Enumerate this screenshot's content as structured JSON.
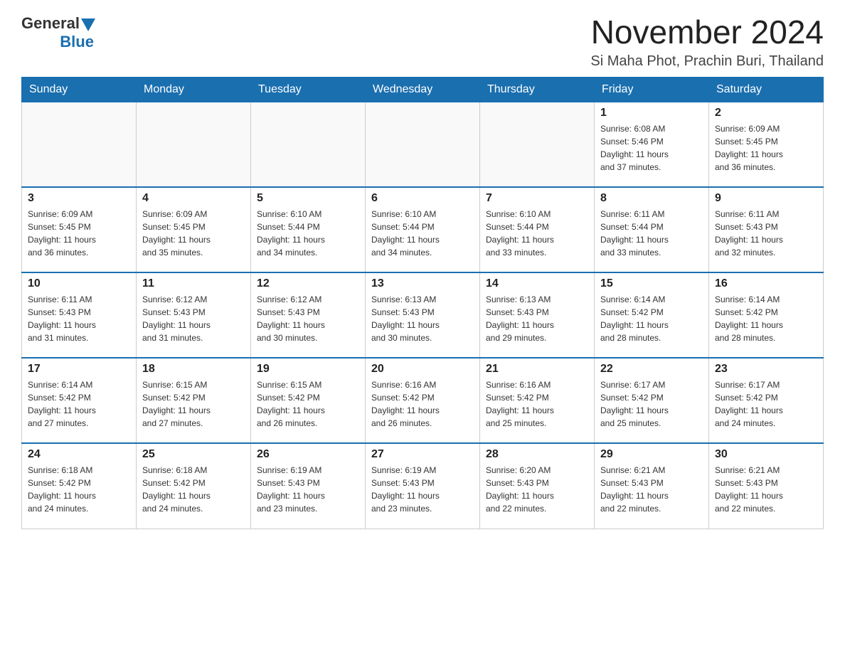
{
  "header": {
    "logo_general": "General",
    "logo_blue": "Blue",
    "month_title": "November 2024",
    "location": "Si Maha Phot, Prachin Buri, Thailand"
  },
  "days_of_week": [
    "Sunday",
    "Monday",
    "Tuesday",
    "Wednesday",
    "Thursday",
    "Friday",
    "Saturday"
  ],
  "weeks": [
    [
      {
        "day": "",
        "info": ""
      },
      {
        "day": "",
        "info": ""
      },
      {
        "day": "",
        "info": ""
      },
      {
        "day": "",
        "info": ""
      },
      {
        "day": "",
        "info": ""
      },
      {
        "day": "1",
        "info": "Sunrise: 6:08 AM\nSunset: 5:46 PM\nDaylight: 11 hours\nand 37 minutes."
      },
      {
        "day": "2",
        "info": "Sunrise: 6:09 AM\nSunset: 5:45 PM\nDaylight: 11 hours\nand 36 minutes."
      }
    ],
    [
      {
        "day": "3",
        "info": "Sunrise: 6:09 AM\nSunset: 5:45 PM\nDaylight: 11 hours\nand 36 minutes."
      },
      {
        "day": "4",
        "info": "Sunrise: 6:09 AM\nSunset: 5:45 PM\nDaylight: 11 hours\nand 35 minutes."
      },
      {
        "day": "5",
        "info": "Sunrise: 6:10 AM\nSunset: 5:44 PM\nDaylight: 11 hours\nand 34 minutes."
      },
      {
        "day": "6",
        "info": "Sunrise: 6:10 AM\nSunset: 5:44 PM\nDaylight: 11 hours\nand 34 minutes."
      },
      {
        "day": "7",
        "info": "Sunrise: 6:10 AM\nSunset: 5:44 PM\nDaylight: 11 hours\nand 33 minutes."
      },
      {
        "day": "8",
        "info": "Sunrise: 6:11 AM\nSunset: 5:44 PM\nDaylight: 11 hours\nand 33 minutes."
      },
      {
        "day": "9",
        "info": "Sunrise: 6:11 AM\nSunset: 5:43 PM\nDaylight: 11 hours\nand 32 minutes."
      }
    ],
    [
      {
        "day": "10",
        "info": "Sunrise: 6:11 AM\nSunset: 5:43 PM\nDaylight: 11 hours\nand 31 minutes."
      },
      {
        "day": "11",
        "info": "Sunrise: 6:12 AM\nSunset: 5:43 PM\nDaylight: 11 hours\nand 31 minutes."
      },
      {
        "day": "12",
        "info": "Sunrise: 6:12 AM\nSunset: 5:43 PM\nDaylight: 11 hours\nand 30 minutes."
      },
      {
        "day": "13",
        "info": "Sunrise: 6:13 AM\nSunset: 5:43 PM\nDaylight: 11 hours\nand 30 minutes."
      },
      {
        "day": "14",
        "info": "Sunrise: 6:13 AM\nSunset: 5:43 PM\nDaylight: 11 hours\nand 29 minutes."
      },
      {
        "day": "15",
        "info": "Sunrise: 6:14 AM\nSunset: 5:42 PM\nDaylight: 11 hours\nand 28 minutes."
      },
      {
        "day": "16",
        "info": "Sunrise: 6:14 AM\nSunset: 5:42 PM\nDaylight: 11 hours\nand 28 minutes."
      }
    ],
    [
      {
        "day": "17",
        "info": "Sunrise: 6:14 AM\nSunset: 5:42 PM\nDaylight: 11 hours\nand 27 minutes."
      },
      {
        "day": "18",
        "info": "Sunrise: 6:15 AM\nSunset: 5:42 PM\nDaylight: 11 hours\nand 27 minutes."
      },
      {
        "day": "19",
        "info": "Sunrise: 6:15 AM\nSunset: 5:42 PM\nDaylight: 11 hours\nand 26 minutes."
      },
      {
        "day": "20",
        "info": "Sunrise: 6:16 AM\nSunset: 5:42 PM\nDaylight: 11 hours\nand 26 minutes."
      },
      {
        "day": "21",
        "info": "Sunrise: 6:16 AM\nSunset: 5:42 PM\nDaylight: 11 hours\nand 25 minutes."
      },
      {
        "day": "22",
        "info": "Sunrise: 6:17 AM\nSunset: 5:42 PM\nDaylight: 11 hours\nand 25 minutes."
      },
      {
        "day": "23",
        "info": "Sunrise: 6:17 AM\nSunset: 5:42 PM\nDaylight: 11 hours\nand 24 minutes."
      }
    ],
    [
      {
        "day": "24",
        "info": "Sunrise: 6:18 AM\nSunset: 5:42 PM\nDaylight: 11 hours\nand 24 minutes."
      },
      {
        "day": "25",
        "info": "Sunrise: 6:18 AM\nSunset: 5:42 PM\nDaylight: 11 hours\nand 24 minutes."
      },
      {
        "day": "26",
        "info": "Sunrise: 6:19 AM\nSunset: 5:43 PM\nDaylight: 11 hours\nand 23 minutes."
      },
      {
        "day": "27",
        "info": "Sunrise: 6:19 AM\nSunset: 5:43 PM\nDaylight: 11 hours\nand 23 minutes."
      },
      {
        "day": "28",
        "info": "Sunrise: 6:20 AM\nSunset: 5:43 PM\nDaylight: 11 hours\nand 22 minutes."
      },
      {
        "day": "29",
        "info": "Sunrise: 6:21 AM\nSunset: 5:43 PM\nDaylight: 11 hours\nand 22 minutes."
      },
      {
        "day": "30",
        "info": "Sunrise: 6:21 AM\nSunset: 5:43 PM\nDaylight: 11 hours\nand 22 minutes."
      }
    ]
  ]
}
